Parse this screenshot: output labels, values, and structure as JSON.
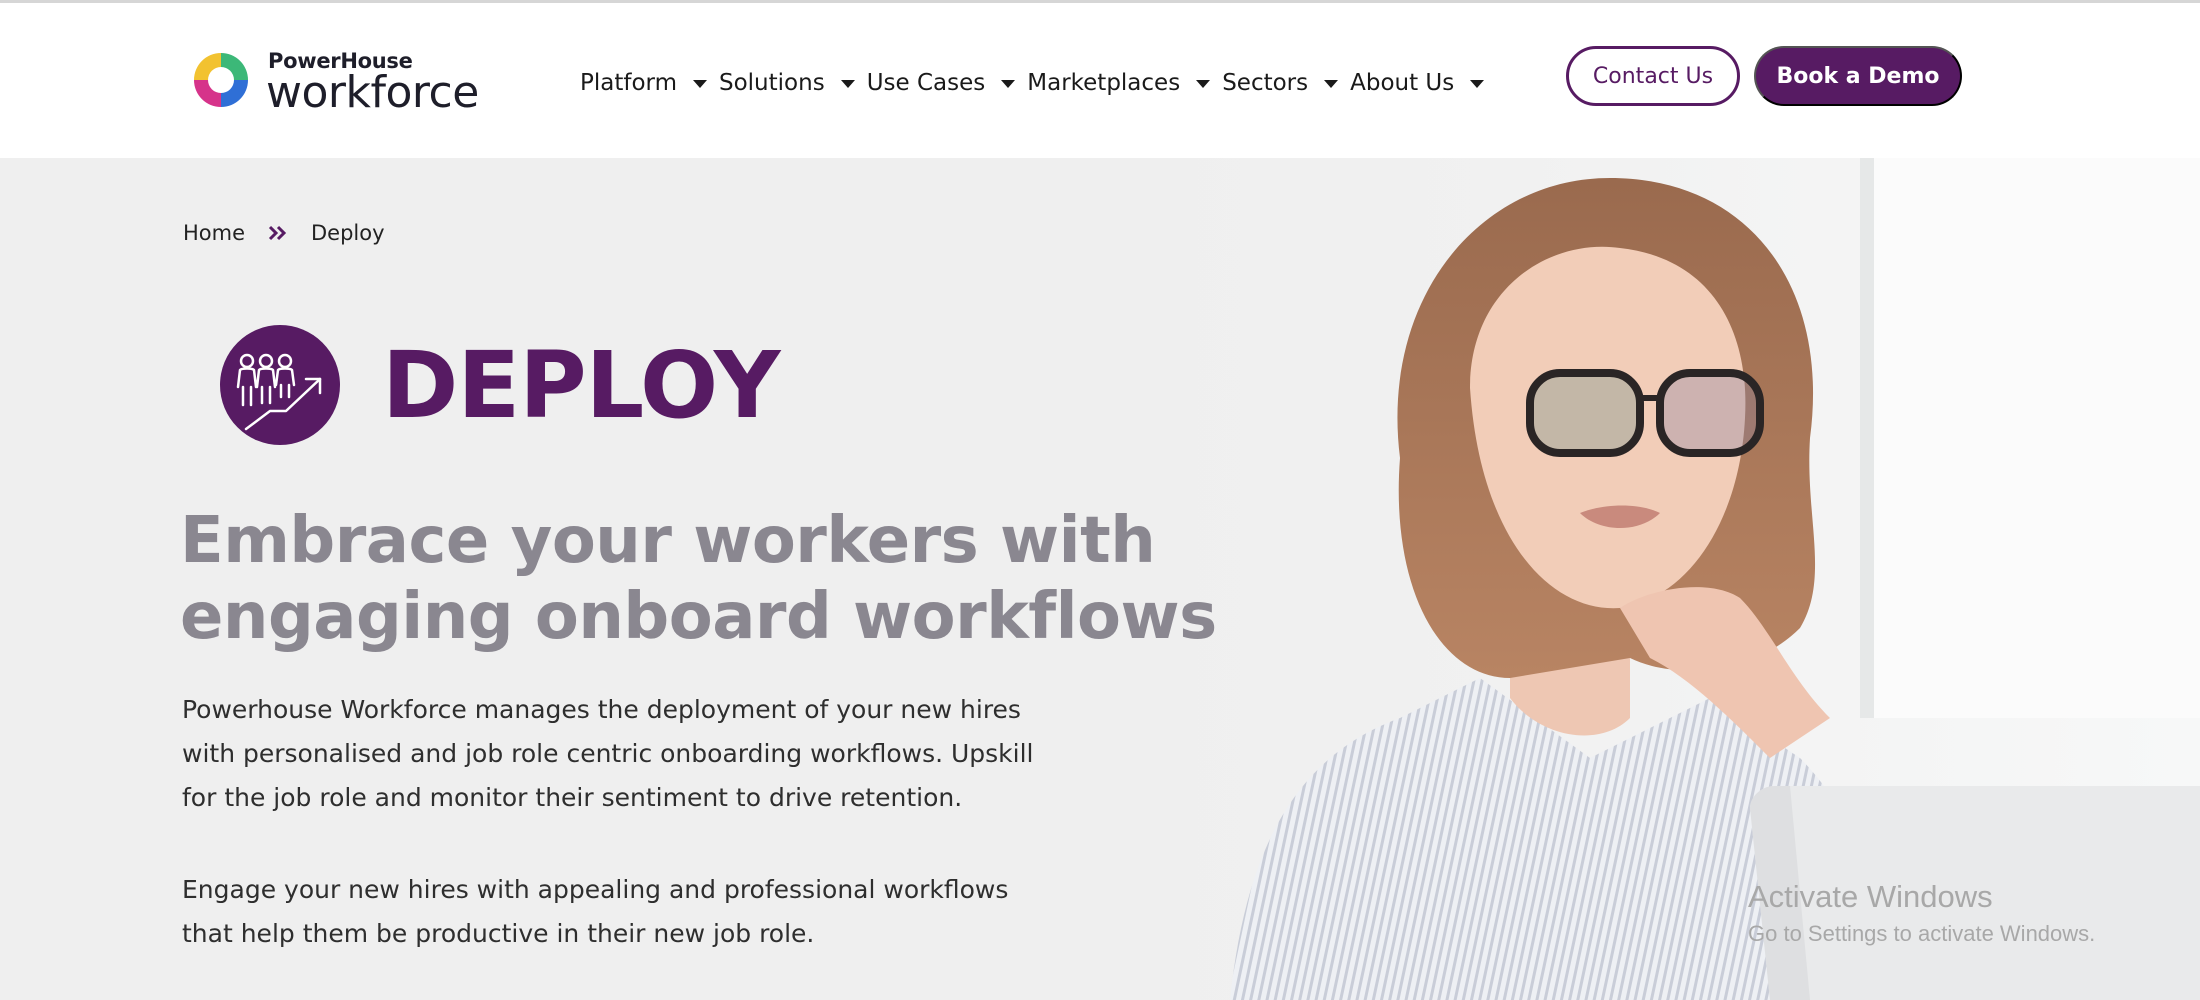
{
  "header": {
    "logo": {
      "brand_top": "PowerHouse",
      "brand_main": "workforce"
    },
    "nav": [
      {
        "label": "Platform",
        "icon": "chevron-down-icon"
      },
      {
        "label": "Solutions",
        "icon": "chevron-down-icon"
      },
      {
        "label": "Use Cases",
        "icon": "chevron-down-icon"
      },
      {
        "label": "Marketplaces",
        "icon": "chevron-down-icon"
      },
      {
        "label": "Sectors",
        "icon": "chevron-down-icon"
      },
      {
        "label": "About Us",
        "icon": "chevron-down-icon"
      }
    ],
    "contact_label": "Contact Us",
    "demo_label": "Book a Demo"
  },
  "breadcrumb": {
    "home": "Home",
    "current": "Deploy",
    "separator_icon": "double-chevron-right-icon"
  },
  "hero": {
    "badge_icon": "team-growth-icon",
    "title": "DEPLOY",
    "headline_line1": "Embrace your workers with",
    "headline_line2": "engaging onboard workflows",
    "paragraph1": [
      "Powerhouse Workforce manages the deployment of your new hires",
      "with personalised and job role centric onboarding workflows. Upskill",
      "for the job role and monitor their sentiment to drive retention."
    ],
    "paragraph2": [
      "Engage your new hires with appealing and professional workflows",
      "that help them be productive in their new job role."
    ],
    "image_subject": "woman-with-glasses-at-laptop"
  },
  "watermark": {
    "line1": "Activate Windows",
    "line2": "Go to Settings to activate Windows."
  },
  "colors": {
    "brand_purple": "#571b63",
    "headline_gray": "#8a8790",
    "hero_background": "#efefef"
  }
}
